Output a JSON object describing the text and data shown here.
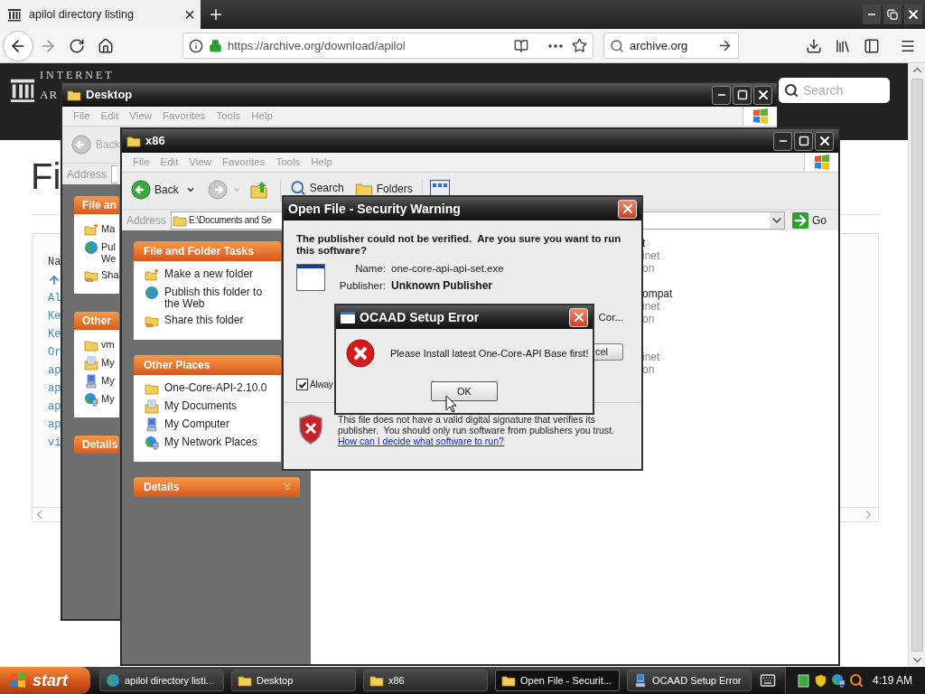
{
  "browser": {
    "tab": {
      "title": "apilol directory listing",
      "close": "×"
    },
    "new_tab": "+",
    "url": "https://archive.org/download/apilol",
    "search": "archive.org"
  },
  "page": {
    "logo": [
      "INTERNET",
      "AR"
    ],
    "search_placeholder": "Search",
    "heading": "Fi",
    "listing_header": "Na",
    "listing": [
      "Al",
      "Ke",
      "Ke",
      "Or",
      "ap",
      "ap",
      "ap",
      "ap",
      "vi"
    ]
  },
  "desktop_window": {
    "title": "Desktop",
    "menu": [
      "File",
      "Edit",
      "View",
      "Favorites",
      "Tools",
      "Help"
    ],
    "back": "Back",
    "address_label": "Address",
    "panes": [
      {
        "title": "File an",
        "items": [
          {
            "kind": "new-folder",
            "text": "Ma"
          },
          {
            "kind": "globe",
            "text": "Pul\nWe"
          },
          {
            "kind": "share",
            "text": "Sha"
          }
        ]
      },
      {
        "title": "Other",
        "items": [
          {
            "kind": "folder",
            "text": "vm"
          },
          {
            "kind": "documents",
            "text": "My"
          },
          {
            "kind": "computer",
            "text": "My"
          },
          {
            "kind": "network",
            "text": "My"
          }
        ]
      },
      {
        "title": "Details"
      }
    ]
  },
  "x86_window": {
    "title": "x86",
    "menu": [
      "File",
      "Edit",
      "View",
      "Favorites",
      "Tools",
      "Help"
    ],
    "toolbar": {
      "back": "Back",
      "search": "Search",
      "folders": "Folders"
    },
    "address_label": "Address",
    "address": "E:\\Documents and Se",
    "go": "Go",
    "panes": [
      {
        "title": "File and Folder Tasks",
        "items": [
          {
            "kind": "new-folder",
            "text": "Make a new folder"
          },
          {
            "kind": "globe",
            "text": "Publish this folder to the Web"
          },
          {
            "kind": "share",
            "text": "Share this folder"
          }
        ]
      },
      {
        "title": "Other Places",
        "items": [
          {
            "kind": "folder",
            "text": "One-Core-API-2.10.0"
          },
          {
            "kind": "documents",
            "text": "My Documents"
          },
          {
            "kind": "computer",
            "text": "My Computer"
          },
          {
            "kind": "network",
            "text": "My Network Places"
          }
        ]
      },
      {
        "title": "Details"
      }
    ],
    "files": [
      {
        "name": "t",
        "lines": [
          "inet",
          "on"
        ]
      },
      {
        "name": "ompat",
        "lines": [
          "inet",
          "on"
        ]
      },
      {
        "lines": [
          "inet",
          "on"
        ]
      }
    ]
  },
  "security_dialog": {
    "title": "Open File - Security Warning",
    "heading": "The publisher could not be verified.  Are you sure you want to run this software?",
    "fields": [
      {
        "label": "Name:",
        "value": "one-core-api-api-set.exe",
        "emphasized": false
      },
      {
        "label": "Publisher:",
        "value": "Unknown Publisher",
        "emphasized": true
      }
    ],
    "from_value": "Cor...",
    "cancel": "cel",
    "checkbox": {
      "label": "Alway",
      "checked": true
    },
    "note": "This file does not have a valid digital signature that verifies its publisher.  You should only run software from publishers you trust.",
    "link": "How can I decide what software to run?"
  },
  "error_dialog": {
    "title": "OCAAD Setup Error",
    "message": "Please Install latest One-Core-API Base first!",
    "ok": "OK"
  },
  "taskbar": {
    "start": "start",
    "buttons": [
      {
        "kind": "browser",
        "label": "apilol directory listi...",
        "selected": false
      },
      {
        "kind": "folder",
        "label": "Desktop",
        "selected": false
      },
      {
        "kind": "folder",
        "label": "x86",
        "selected": false
      },
      {
        "kind": "folder",
        "label": "Open File - Securit...",
        "selected": true
      },
      {
        "kind": "setup",
        "label": "OCAAD Setup Error",
        "selected": false
      }
    ],
    "time": "4:19 AM"
  }
}
